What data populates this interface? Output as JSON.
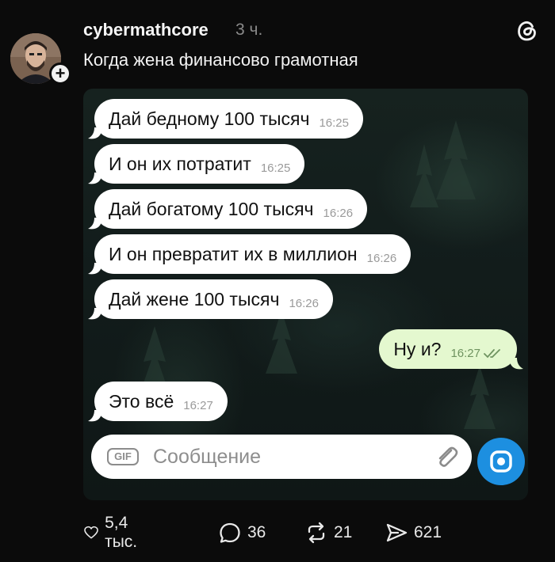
{
  "post": {
    "username": "cybermathcore",
    "time_ago": "3 ч.",
    "caption": "Когда жена финансово грамотная",
    "follow_label": "+"
  },
  "chat": {
    "messages": [
      {
        "direction": "incoming",
        "text": "Дай бедному 100 тысяч",
        "time": "16:25"
      },
      {
        "direction": "incoming",
        "text": "И он их потратит",
        "time": "16:25"
      },
      {
        "direction": "incoming",
        "text": "Дай богатому 100 тысяч",
        "time": "16:26"
      },
      {
        "direction": "incoming",
        "text": "И он превратит их в миллион",
        "time": "16:26"
      },
      {
        "direction": "incoming",
        "text": "Дай жене 100 тысяч",
        "time": "16:26"
      },
      {
        "direction": "outgoing",
        "text": "Ну и?",
        "time": "16:27",
        "status": "read"
      },
      {
        "direction": "incoming",
        "text": "Это всё",
        "time": "16:27"
      }
    ],
    "composer": {
      "gif_label": "GIF",
      "placeholder": "Сообщение",
      "attach_icon": "paperclip-icon",
      "camera_icon": "camera-icon"
    }
  },
  "actions": {
    "likes": "5,4 тыс.",
    "comments": "36",
    "reposts": "21",
    "shares": "621"
  },
  "colors": {
    "background": "#0b0b0b",
    "incoming_bubble": "#ffffff",
    "outgoing_bubble": "#e4f8cf",
    "camera_button": "#1d8fe0",
    "timestamp_muted": "#8a8a8a"
  }
}
